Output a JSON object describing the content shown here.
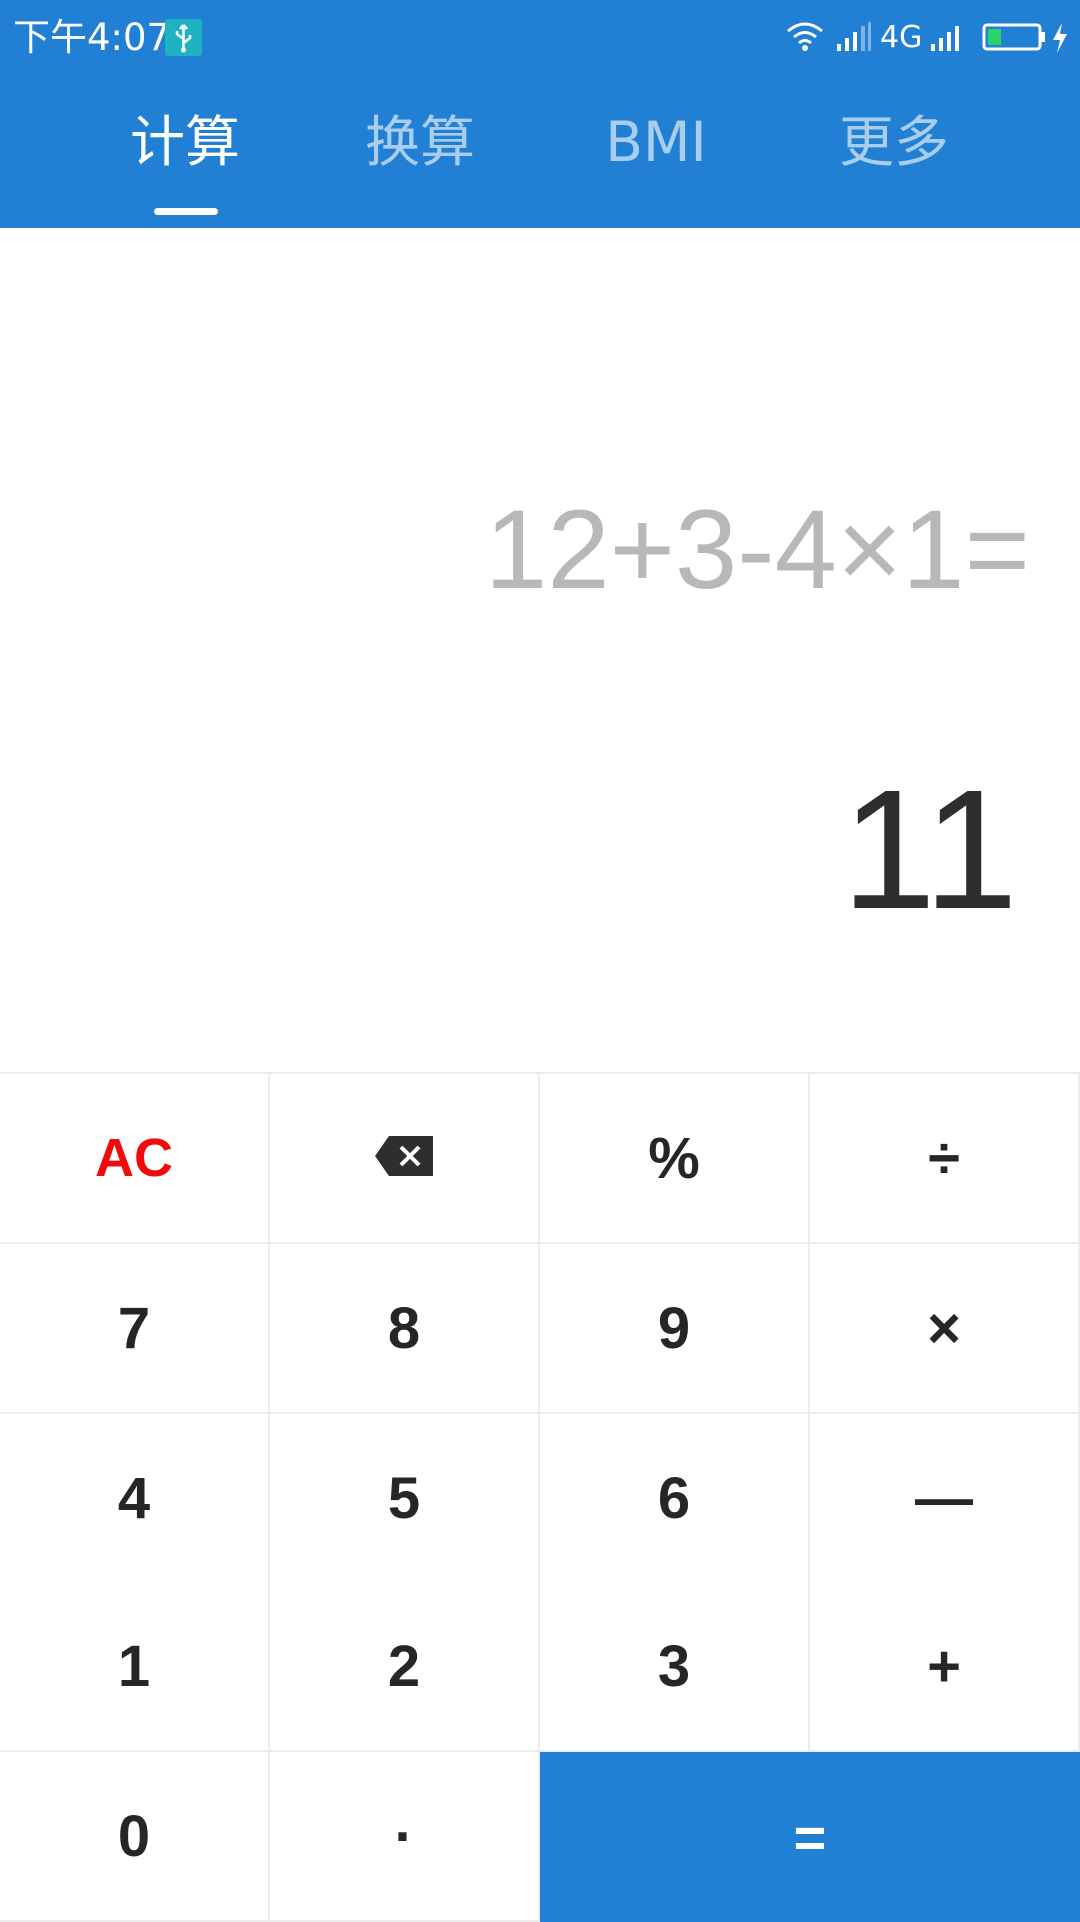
{
  "status_bar": {
    "time": "下午4:07",
    "network": "4G"
  },
  "tabs": [
    {
      "label": "计算",
      "active": true
    },
    {
      "label": "换算",
      "active": false
    },
    {
      "label": "BMI",
      "active": false
    },
    {
      "label": "更多",
      "active": false
    }
  ],
  "display": {
    "expression": "12+3-4×1=",
    "result": "11"
  },
  "keypad": {
    "ac": "AC",
    "backspace_icon": "backspace-icon",
    "percent": "%",
    "divide": "÷",
    "seven": "7",
    "eight": "8",
    "nine": "9",
    "multiply": "×",
    "four": "4",
    "five": "5",
    "six": "6",
    "minus": "—",
    "one": "1",
    "two": "2",
    "three": "3",
    "plus": "+",
    "zero": "0",
    "dot": "·",
    "equals": "="
  },
  "colors": {
    "header": "#2180d3",
    "ac": "#f20a0a",
    "equals_bg": "#2180d3"
  }
}
